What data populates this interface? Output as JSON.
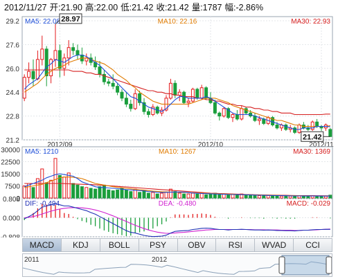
{
  "header": {
    "date": "2012/11/27",
    "open": "开:21.90",
    "high": "高:22.00",
    "low": "低:21.42",
    "close": "收:21.42",
    "volume": "量:1787",
    "change": "幅:-2.86%"
  },
  "colors": {
    "up": "#e41a1c",
    "down": "#1a9e3c",
    "ma5": "#1f4fd8",
    "ma10": "#e07b00",
    "ma30": "#d62020",
    "dif": "#1f2fb5",
    "dea": "#d020d0"
  },
  "chart_data": [
    {
      "type": "candlestick",
      "legend": {
        "ma5": "MA5: 22.08",
        "ma10": "MA10: 22.16",
        "ma30": "MA30: 22.93"
      },
      "y_ticks": [
        "29.2",
        "27.6",
        "26.0",
        "24.4",
        "22.8",
        "21.2"
      ],
      "y_range": [
        21.2,
        29.2
      ],
      "x_labels": [
        "2012/09",
        "2012/10",
        "2012/11"
      ],
      "x_label_index": [
        8,
        42,
        67
      ],
      "annotations": {
        "high": "28.97",
        "last": "21.42"
      },
      "ohlc": [
        [
          24.0,
          25.6,
          23.8,
          25.4
        ],
        [
          25.4,
          26.4,
          25.0,
          25.8
        ],
        [
          25.8,
          26.6,
          24.8,
          25.3
        ],
        [
          25.3,
          27.2,
          25.2,
          26.6
        ],
        [
          26.6,
          28.2,
          26.2,
          27.3
        ],
        [
          27.3,
          27.5,
          24.8,
          25.5
        ],
        [
          25.5,
          26.7,
          25.0,
          26.6
        ],
        [
          26.6,
          28.97,
          26.1,
          27.2
        ],
        [
          27.2,
          27.6,
          25.4,
          26.0
        ],
        [
          26.0,
          27.0,
          25.5,
          26.7
        ],
        [
          26.7,
          27.9,
          26.2,
          27.4
        ],
        [
          27.4,
          27.7,
          26.9,
          27.2
        ],
        [
          27.2,
          27.6,
          26.6,
          26.9
        ],
        [
          26.9,
          27.4,
          26.3,
          26.5
        ],
        [
          26.5,
          27.0,
          26.2,
          26.7
        ],
        [
          26.7,
          27.0,
          26.2,
          26.4
        ],
        [
          26.4,
          26.8,
          25.9,
          26.1
        ],
        [
          26.1,
          26.5,
          25.4,
          25.6
        ],
        [
          25.6,
          25.9,
          24.9,
          25.1
        ],
        [
          25.1,
          25.3,
          24.8,
          25.0
        ],
        [
          25.0,
          25.6,
          24.6,
          24.8
        ],
        [
          24.8,
          25.0,
          24.2,
          24.4
        ],
        [
          24.4,
          24.6,
          23.8,
          24.0
        ],
        [
          24.0,
          24.4,
          23.4,
          23.6
        ],
        [
          23.6,
          23.9,
          23.1,
          23.3
        ],
        [
          23.3,
          24.6,
          23.2,
          24.3
        ],
        [
          24.3,
          24.5,
          23.5,
          23.7
        ],
        [
          23.7,
          24.0,
          22.9,
          23.1
        ],
        [
          23.1,
          23.3,
          22.7,
          22.9
        ],
        [
          22.9,
          23.6,
          22.8,
          23.4
        ],
        [
          23.4,
          23.5,
          22.9,
          23.0
        ],
        [
          23.0,
          23.4,
          22.8,
          23.2
        ],
        [
          23.2,
          24.2,
          23.1,
          24.0
        ],
        [
          24.0,
          25.3,
          23.9,
          25.0
        ],
        [
          25.0,
          25.2,
          24.0,
          24.2
        ],
        [
          24.2,
          24.6,
          23.8,
          24.4
        ],
        [
          24.4,
          24.5,
          23.6,
          23.7
        ],
        [
          23.7,
          24.0,
          23.4,
          23.8
        ],
        [
          23.8,
          24.7,
          23.7,
          24.6
        ],
        [
          24.6,
          24.7,
          23.9,
          24.0
        ],
        [
          24.0,
          24.9,
          23.9,
          24.7
        ],
        [
          24.7,
          24.8,
          23.9,
          24.0
        ],
        [
          24.0,
          24.4,
          23.6,
          23.7
        ],
        [
          23.7,
          23.9,
          22.9,
          23.0
        ],
        [
          23.0,
          23.1,
          22.5,
          22.8
        ],
        [
          22.8,
          23.4,
          22.7,
          23.3
        ],
        [
          23.3,
          23.4,
          22.6,
          22.7
        ],
        [
          22.7,
          23.0,
          22.4,
          22.9
        ],
        [
          22.9,
          23.2,
          22.5,
          22.6
        ],
        [
          22.6,
          23.5,
          22.5,
          23.3
        ],
        [
          23.3,
          23.4,
          22.9,
          23.0
        ],
        [
          23.0,
          23.2,
          22.7,
          22.8
        ],
        [
          22.8,
          23.0,
          22.4,
          22.5
        ],
        [
          22.5,
          22.8,
          22.2,
          22.6
        ],
        [
          22.6,
          22.7,
          22.2,
          22.3
        ],
        [
          22.3,
          22.8,
          22.2,
          22.7
        ],
        [
          22.7,
          22.8,
          22.1,
          22.2
        ],
        [
          22.2,
          22.4,
          21.9,
          22.0
        ],
        [
          22.0,
          22.3,
          21.8,
          22.2
        ],
        [
          22.2,
          22.3,
          21.8,
          21.9
        ],
        [
          21.9,
          22.2,
          21.7,
          22.0
        ],
        [
          22.0,
          22.1,
          21.6,
          21.7
        ],
        [
          21.7,
          22.3,
          21.6,
          22.2
        ],
        [
          22.2,
          22.4,
          21.9,
          22.0
        ],
        [
          22.0,
          22.2,
          21.8,
          21.9
        ],
        [
          21.9,
          22.5,
          21.8,
          22.4
        ],
        [
          22.4,
          22.6,
          22.0,
          22.1
        ],
        [
          22.1,
          22.2,
          21.8,
          22.0
        ],
        [
          22.0,
          22.3,
          21.8,
          22.2
        ],
        [
          21.9,
          22.0,
          21.42,
          21.42
        ]
      ],
      "ma5": [
        24.6,
        24.9,
        25.1,
        25.3,
        25.7,
        26.1,
        26.3,
        26.6,
        26.5,
        26.4,
        26.6,
        26.8,
        26.9,
        26.9,
        26.8,
        26.6,
        26.4,
        26.2,
        25.9,
        25.6,
        25.3,
        25.0,
        24.7,
        24.4,
        24.1,
        24.0,
        23.8,
        23.6,
        23.4,
        23.3,
        23.2,
        23.1,
        23.3,
        23.6,
        23.9,
        24.1,
        24.1,
        24.0,
        24.0,
        24.0,
        24.0,
        24.1,
        24.0,
        23.8,
        23.6,
        23.4,
        23.2,
        23.0,
        22.9,
        22.9,
        22.9,
        22.9,
        22.8,
        22.7,
        22.6,
        22.5,
        22.4,
        22.3,
        22.2,
        22.1,
        22.0,
        21.9,
        21.9,
        22.0,
        22.0,
        22.0,
        22.1,
        22.1,
        22.1,
        22.08
      ],
      "ma10": [
        24.4,
        24.6,
        24.8,
        25.0,
        25.3,
        25.6,
        25.8,
        26.0,
        26.1,
        26.2,
        26.4,
        26.5,
        26.6,
        26.7,
        26.7,
        26.6,
        26.5,
        26.4,
        26.3,
        26.1,
        25.9,
        25.6,
        25.4,
        25.2,
        24.9,
        24.7,
        24.4,
        24.2,
        24.0,
        23.8,
        23.7,
        23.6,
        23.6,
        23.6,
        23.6,
        23.6,
        23.6,
        23.6,
        23.7,
        23.8,
        23.9,
        24.0,
        24.0,
        24.0,
        23.9,
        23.8,
        23.7,
        23.5,
        23.4,
        23.3,
        23.2,
        23.1,
        23.0,
        22.9,
        22.8,
        22.7,
        22.6,
        22.5,
        22.5,
        22.4,
        22.3,
        22.2,
        22.2,
        22.1,
        22.1,
        22.1,
        22.1,
        22.1,
        22.1,
        22.16
      ],
      "ma30": [
        25.9,
        25.9,
        25.9,
        25.9,
        25.9,
        25.9,
        25.9,
        25.9,
        25.9,
        25.9,
        25.9,
        25.8,
        25.8,
        25.8,
        25.7,
        25.7,
        25.6,
        25.6,
        25.5,
        25.4,
        25.3,
        25.2,
        25.1,
        25.0,
        24.9,
        24.8,
        24.7,
        24.6,
        24.5,
        24.5,
        24.4,
        24.4,
        24.3,
        24.3,
        24.2,
        24.2,
        24.1,
        24.1,
        24.1,
        24.0,
        24.0,
        23.9,
        23.9,
        23.8,
        23.8,
        23.7,
        23.6,
        23.6,
        23.5,
        23.5,
        23.4,
        23.4,
        23.3,
        23.3,
        23.2,
        23.2,
        23.1,
        23.1,
        23.0,
        23.0,
        23.0,
        22.9,
        22.9,
        22.9,
        22.9,
        22.9,
        22.9,
        22.9,
        22.93,
        22.93
      ]
    },
    {
      "type": "bar",
      "legend": {
        "ma5": "MA5: 1210",
        "ma10": "MA10: 1267",
        "ma30": "MA30: 1369"
      },
      "y_ticks": [
        "30000",
        "22500",
        "15000",
        "7500",
        "0"
      ],
      "y_range": [
        0,
        30000
      ],
      "volume": [
        7500,
        9000,
        6500,
        12000,
        18000,
        9500,
        11000,
        24500,
        14000,
        13000,
        15500,
        9000,
        8000,
        7000,
        6500,
        6000,
        5500,
        7000,
        8000,
        5000,
        4500,
        5000,
        6000,
        5000,
        4000,
        5500,
        3500,
        4500,
        3000,
        3500,
        2500,
        3000,
        3500,
        5500,
        4000,
        3000,
        2500,
        2500,
        3000,
        2500,
        3000,
        2000,
        2500,
        3000,
        2000,
        2500,
        2000,
        2200,
        1800,
        2500,
        1800,
        1700,
        1600,
        1500,
        1400,
        1600,
        1300,
        1500,
        1200,
        1300,
        1200,
        1100,
        1400,
        1200,
        1100,
        1300,
        1200,
        1000,
        1100,
        1787
      ],
      "ma5": [
        7000,
        8000,
        9000,
        10000,
        11000,
        12500,
        13500,
        14500,
        15000,
        14500,
        14000,
        13500,
        12000,
        10000,
        9000,
        8000,
        7000,
        6500,
        6500,
        6200,
        6000,
        5800,
        5500,
        5200,
        5000,
        4800,
        4600,
        4400,
        4000,
        3800,
        3500,
        3400,
        3500,
        3600,
        3700,
        3700,
        3600,
        3300,
        3100,
        2900,
        2800,
        2700,
        2600,
        2500,
        2400,
        2300,
        2200,
        2150,
        2100,
        2050,
        2000,
        1900,
        1800,
        1700,
        1650,
        1600,
        1550,
        1500,
        1450,
        1400,
        1350,
        1300,
        1280,
        1260,
        1250,
        1240,
        1230,
        1220,
        1215,
        1210
      ],
      "ma10": [
        6500,
        7000,
        7500,
        8000,
        8500,
        9500,
        10500,
        11500,
        12500,
        13000,
        13000,
        12800,
        12500,
        12000,
        11000,
        10000,
        9000,
        8500,
        8000,
        7500,
        7000,
        6600,
        6300,
        6000,
        5700,
        5400,
        5100,
        4900,
        4600,
        4300,
        4100,
        3900,
        3800,
        3700,
        3600,
        3500,
        3400,
        3300,
        3200,
        3100,
        3000,
        2900,
        2800,
        2700,
        2600,
        2500,
        2400,
        2300,
        2200,
        2150,
        2100,
        2000,
        1900,
        1850,
        1800,
        1700,
        1650,
        1600,
        1550,
        1500,
        1450,
        1400,
        1380,
        1350,
        1320,
        1300,
        1290,
        1280,
        1270,
        1267
      ],
      "ma30": [
        9000,
        9000,
        9000,
        9000,
        9000,
        9000,
        9000,
        9000,
        9000,
        8900,
        8800,
        8700,
        8600,
        8500,
        8400,
        8300,
        8200,
        8000,
        7800,
        7600,
        7400,
        7200,
        7000,
        6800,
        6600,
        6400,
        6200,
        6000,
        5800,
        5600,
        5400,
        5200,
        5000,
        4800,
        4600,
        4400,
        4200,
        4000,
        3800,
        3600,
        3400,
        3200,
        3000,
        2900,
        2800,
        2700,
        2600,
        2500,
        2400,
        2300,
        2200,
        2100,
        2000,
        1950,
        1900,
        1850,
        1800,
        1750,
        1700,
        1650,
        1600,
        1550,
        1500,
        1480,
        1460,
        1440,
        1420,
        1400,
        1380,
        1369
      ]
    },
    {
      "type": "macd",
      "legend": {
        "dif": "DIF: -0.494",
        "dea": "DEA: -0.480",
        "macd": "MACD: -0.029"
      },
      "y_ticks": [
        "0.808",
        "0.000",
        "-0.808"
      ],
      "y_range": [
        -0.808,
        0.808
      ],
      "dif": [
        -0.05,
        0.05,
        0.15,
        0.3,
        0.45,
        0.5,
        0.55,
        0.6,
        0.55,
        0.5,
        0.5,
        0.45,
        0.4,
        0.35,
        0.3,
        0.22,
        0.15,
        0.05,
        -0.05,
        -0.15,
        -0.25,
        -0.35,
        -0.45,
        -0.55,
        -0.62,
        -0.65,
        -0.7,
        -0.75,
        -0.78,
        -0.8,
        -0.79,
        -0.78,
        -0.74,
        -0.65,
        -0.58,
        -0.56,
        -0.55,
        -0.54,
        -0.5,
        -0.48,
        -0.45,
        -0.44,
        -0.45,
        -0.48,
        -0.5,
        -0.5,
        -0.52,
        -0.5,
        -0.5,
        -0.49,
        -0.5,
        -0.51,
        -0.52,
        -0.52,
        -0.53,
        -0.52,
        -0.53,
        -0.54,
        -0.54,
        -0.55,
        -0.55,
        -0.56,
        -0.54,
        -0.53,
        -0.53,
        -0.51,
        -0.5,
        -0.5,
        -0.49,
        -0.494
      ],
      "dea": [
        0.0,
        0.02,
        0.05,
        0.1,
        0.16,
        0.22,
        0.28,
        0.33,
        0.37,
        0.4,
        0.42,
        0.43,
        0.43,
        0.42,
        0.4,
        0.37,
        0.33,
        0.28,
        0.22,
        0.15,
        0.08,
        0.0,
        -0.08,
        -0.16,
        -0.24,
        -0.32,
        -0.39,
        -0.46,
        -0.52,
        -0.57,
        -0.61,
        -0.64,
        -0.66,
        -0.66,
        -0.65,
        -0.63,
        -0.62,
        -0.6,
        -0.58,
        -0.56,
        -0.54,
        -0.52,
        -0.51,
        -0.5,
        -0.5,
        -0.5,
        -0.5,
        -0.5,
        -0.5,
        -0.5,
        -0.5,
        -0.5,
        -0.51,
        -0.51,
        -0.51,
        -0.52,
        -0.52,
        -0.52,
        -0.53,
        -0.53,
        -0.53,
        -0.54,
        -0.54,
        -0.53,
        -0.53,
        -0.52,
        -0.51,
        -0.5,
        -0.49,
        -0.48
      ]
    }
  ],
  "tabs": [
    "MACD",
    "KDJ",
    "BOLL",
    "PSY",
    "OBV",
    "RSI",
    "WVAD",
    "CCI"
  ],
  "active_tab": "MACD",
  "navigator": {
    "years": [
      "2011",
      "2012"
    ]
  }
}
